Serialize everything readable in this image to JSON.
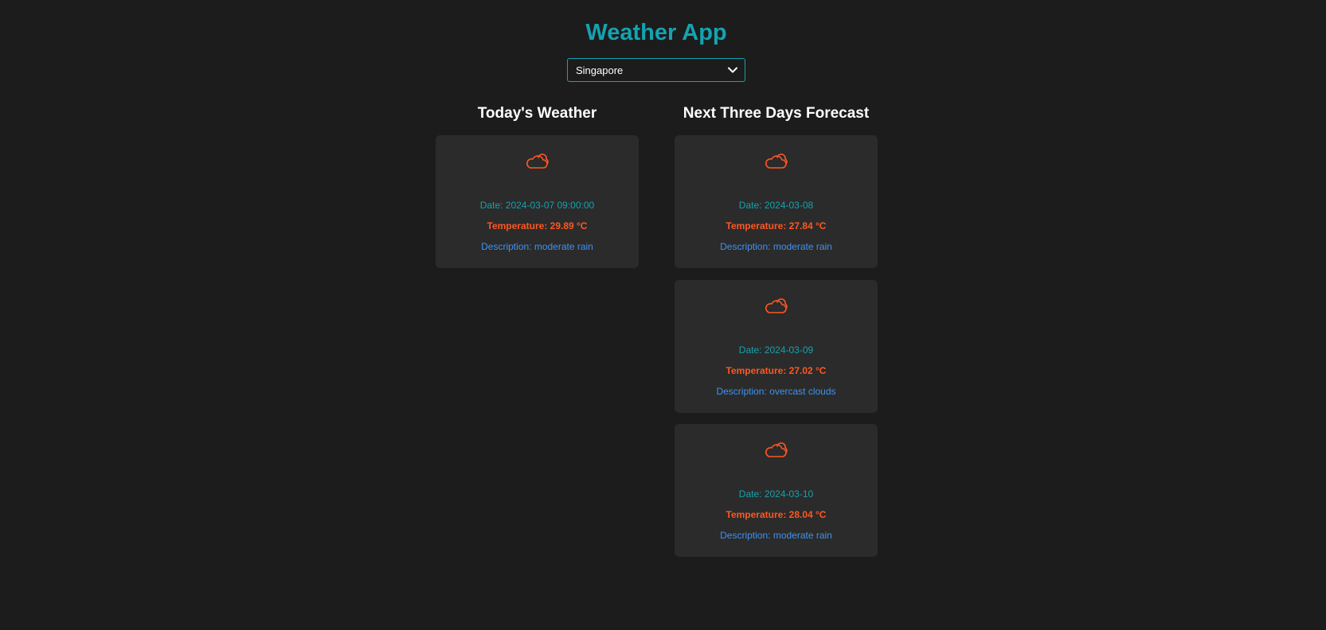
{
  "app": {
    "title": "Weather App"
  },
  "city_select": {
    "selected": "Singapore",
    "icon": "chevron-down-icon"
  },
  "today": {
    "heading": "Today's Weather",
    "card": {
      "icon": "cloud-icon",
      "date": "Date: 2024-03-07 09:00:00",
      "temperature": "Temperature: 29.89 °C",
      "description": "Description: moderate rain"
    }
  },
  "forecast": {
    "heading": "Next Three Days Forecast",
    "cards": [
      {
        "icon": "cloud-icon",
        "date": "Date: 2024-03-08",
        "temperature": "Temperature: 27.84 °C",
        "description": "Description: moderate rain"
      },
      {
        "icon": "cloud-icon",
        "date": "Date: 2024-03-09",
        "temperature": "Temperature: 27.02 °C",
        "description": "Description: overcast clouds"
      },
      {
        "icon": "cloud-icon",
        "date": "Date: 2024-03-10",
        "temperature": "Temperature: 28.04 °C",
        "description": "Description: moderate rain"
      }
    ]
  },
  "colors": {
    "background": "#1c1c1c",
    "accent": "#14a3b0",
    "card": "#2b2b2b",
    "temperature": "#ff5722",
    "description": "#3f92f0",
    "icon": "#ff5722"
  }
}
